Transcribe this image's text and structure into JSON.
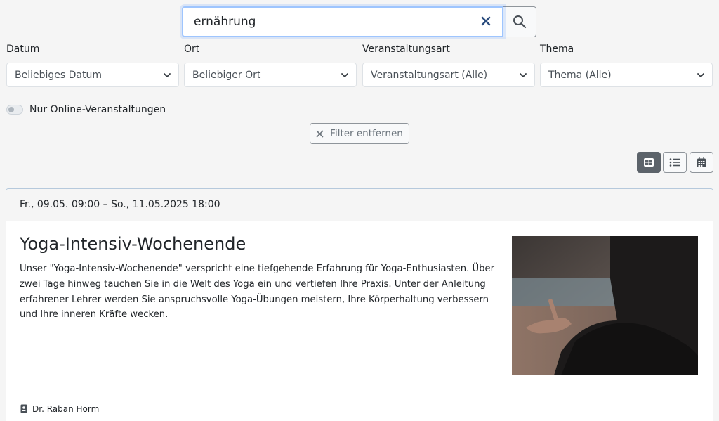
{
  "search": {
    "value": "ernährung",
    "button_icon": "search-icon",
    "clear_icon": "close-icon"
  },
  "filters": [
    {
      "label": "Datum",
      "value": "Beliebiges Datum"
    },
    {
      "label": "Ort",
      "value": "Beliebiger Ort"
    },
    {
      "label": "Veranstaltungsart",
      "value": "Veranstaltungsart (Alle)"
    },
    {
      "label": "Thema",
      "value": "Thema (Alle)"
    }
  ],
  "online_toggle": {
    "label": "Nur Online-Veranstaltungen",
    "checked": false
  },
  "remove_filter_label": "Filter entfernen",
  "views": [
    {
      "icon": "grid-view-icon",
      "active": true
    },
    {
      "icon": "list-view-icon",
      "active": false
    },
    {
      "icon": "calendar-view-icon",
      "active": false
    }
  ],
  "event": {
    "date": "Fr., 09.05. 09:00 – So., 11.05.2025 18:00",
    "title": "Yoga-Intensiv-Wochenende",
    "description": "Unser \"Yoga-Intensiv-Wochenende\" verspricht eine tiefgehende Erfahrung für Yoga-Enthusiasten. Über zwei Tage hinweg tauchen Sie in die Welt des Yoga ein und vertiefen Ihre Praxis. Unter der Anleitung erfahre­ner Lehrer werden Sie anspruchsvolle Yoga-Übungen meistern, Ihre Körperhaltung verbessern und Ihre in­neren Kräfte wecken.",
    "instructor": "Dr. Raban Horm"
  },
  "colors": {
    "accent": "#9ec5fe",
    "clear_icon": "#2b4c7e",
    "active_view": "#5c636a"
  }
}
